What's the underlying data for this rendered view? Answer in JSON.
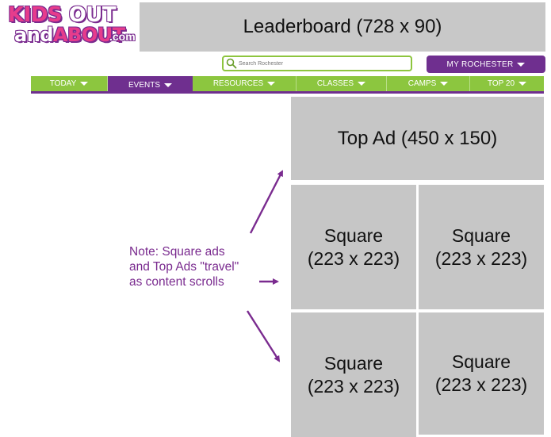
{
  "logo": {
    "line1_a": "KIDS",
    "line1_b": "OUT",
    "line2_a": "and",
    "line2_b": "ABOUT",
    "line2_c": ".com"
  },
  "ads": {
    "leaderboard": "Leaderboard (728 x 90)",
    "top_ad": "Top Ad (450 x 150)",
    "squares": [
      {
        "line1": "Square",
        "line2": "(223 x 223)"
      },
      {
        "line1": "Square",
        "line2": "(223 x 223)"
      },
      {
        "line1": "Square",
        "line2": "(223 x 223)"
      },
      {
        "line1": "Square",
        "line2": "(223 x 223)"
      }
    ]
  },
  "search": {
    "placeholder": "Search Rochester",
    "icon": "search-icon"
  },
  "city_button": {
    "label": "MY ROCHESTER"
  },
  "nav": {
    "items": [
      {
        "label": "TODAY"
      },
      {
        "label": "EVENTS"
      },
      {
        "label": "RESOURCES"
      },
      {
        "label": "CLASSES"
      },
      {
        "label": "CAMPS"
      },
      {
        "label": "TOP 20"
      }
    ],
    "active_index": 1
  },
  "note": {
    "lines": [
      "Note: Square ads",
      "and Top Ads \"travel\"",
      "as content scrolls"
    ]
  },
  "colors": {
    "purple": "#6f2f8f",
    "green": "#8cc63f",
    "ad_gray": "#c6c6c6",
    "pink": "#e63c8c"
  }
}
